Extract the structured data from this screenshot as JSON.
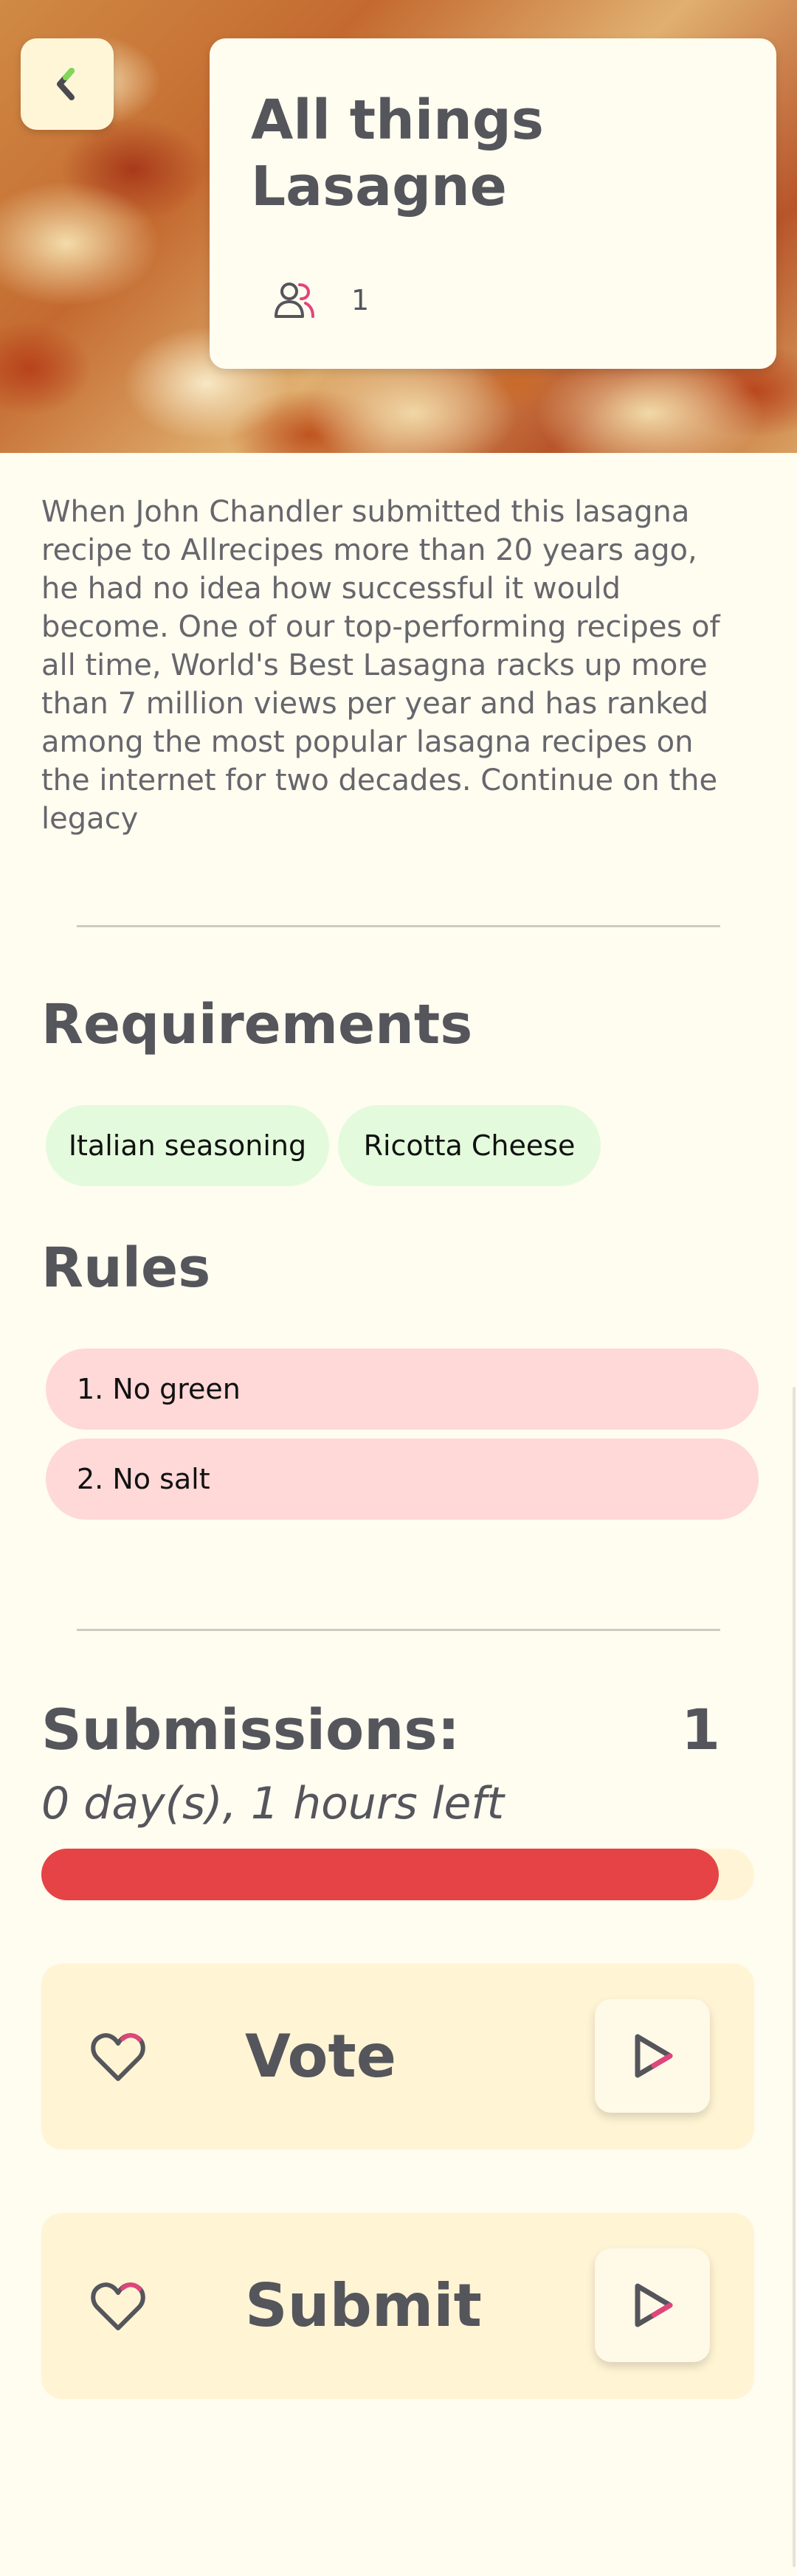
{
  "header": {
    "title": "All things Lasagne",
    "member_count": "1"
  },
  "description": "When John Chandler submitted this lasagna recipe to Allrecipes more than 20 years ago, he had no idea how successful it would become. One of our top-performing recipes of all time, World's Best Lasagna racks up more than 7 million views per year and has ranked among the most popular lasagna recipes on the internet for two decades. Continue on the legacy",
  "requirements": {
    "title": "Requirements",
    "items": [
      "Italian seasoning",
      "Ricotta Cheese"
    ]
  },
  "rules": {
    "title": "Rules",
    "items": [
      "1. No green",
      "2. No salt"
    ]
  },
  "submissions": {
    "label": "Submissions:",
    "count": "1",
    "time_left": "0 day(s), 1 hours left",
    "progress_fraction": 0.95
  },
  "actions": {
    "vote_label": "Vote",
    "submit_label": "Submit"
  },
  "colors": {
    "background": "#fffcf0",
    "requirement_chip": "#e3fbdc",
    "rule_chip": "#ffd8d8",
    "progress": "#e54346",
    "action_card": "#fff4d4",
    "accent_pink": "#e0457b",
    "accent_green": "#7ed957"
  },
  "icons": {
    "back": "chevron-left-icon",
    "members": "users-icon",
    "heart": "heart-icon",
    "play": "play-icon"
  }
}
